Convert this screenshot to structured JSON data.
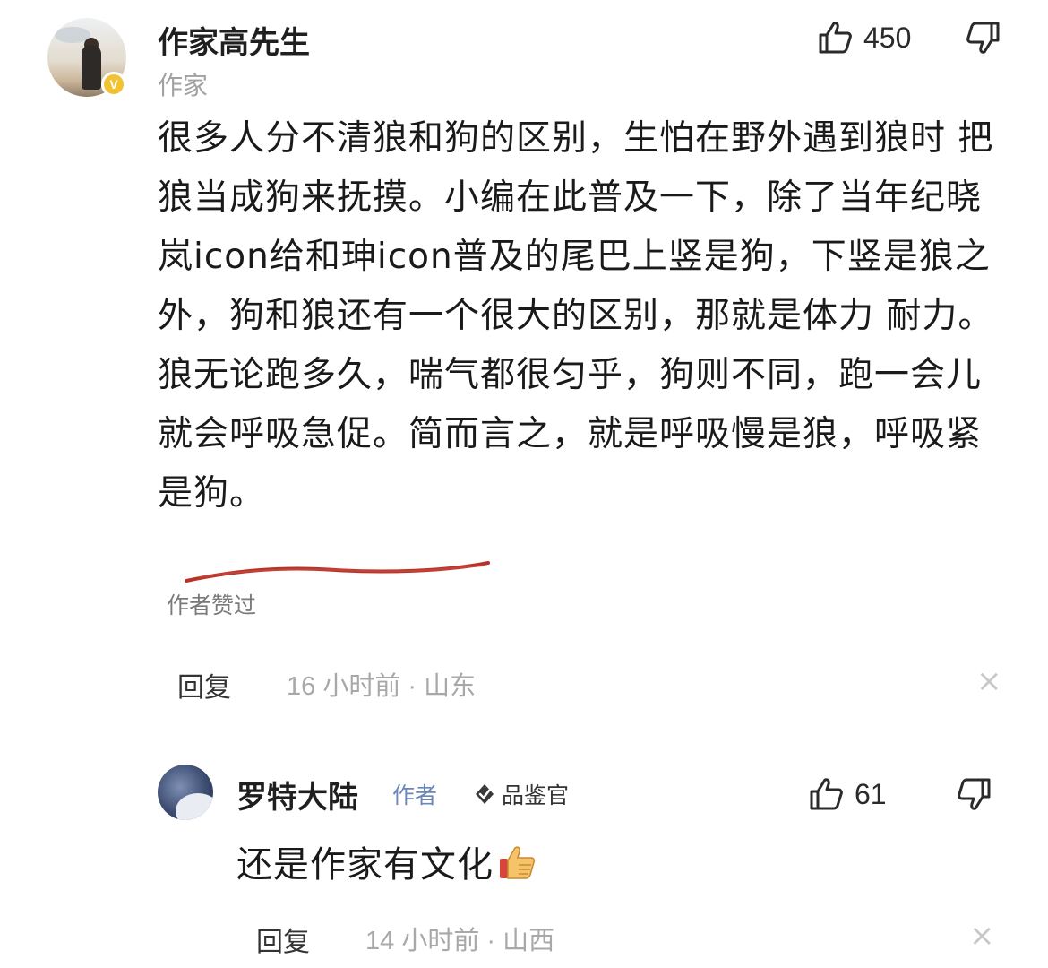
{
  "comment": {
    "author": "作家高先生",
    "role": "作家",
    "likes": "450",
    "paragraphs": [
      "很多人分不清狼和狗的区别，生怕在野外遇到狼时 把狼当成狗来抚摸。小编在此普及一下，除了当年纪晓岚icon给和珅icon普及的尾巴上竖是狗，下竖是狼之外，狗和狼还有一个很大的区别，那就是体力 耐力。",
      "狼无论跑多久，喘气都很匀乎，狗则不同，跑一会儿就会呼吸急促。简而言之，就是呼吸慢是狼，呼吸紧是狗。"
    ],
    "liked_by_author": "作者赞过",
    "reply_label": "回复",
    "meta": "16 小时前 · 山东",
    "close_symbol": "×"
  },
  "reply": {
    "author": "罗特大陆",
    "author_tag": "作者",
    "badge": "品鉴官",
    "likes": "61",
    "text": "还是作家有文化",
    "reply_label": "回复",
    "meta": "14 小时前 · 山西",
    "close_symbol": "×"
  },
  "icons": {
    "verified_badge": "V",
    "like": "thumbs-up-outline-icon",
    "dislike": "thumbs-down-outline-icon",
    "thumb_emoji": "thumbs-up-emoji"
  },
  "colors": {
    "underline": "#b8322a",
    "verified": "#f1c232",
    "author_tag": "#6b86b8",
    "meta": "#a8a8a8"
  }
}
